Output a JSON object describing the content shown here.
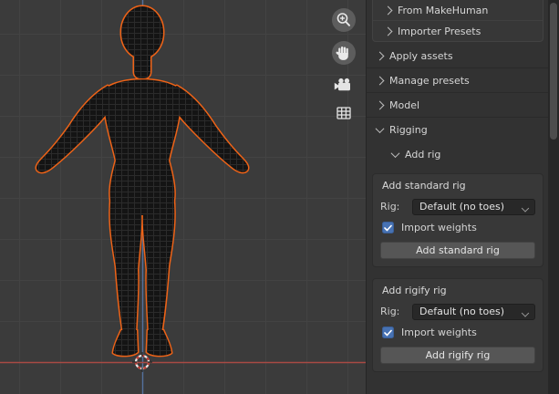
{
  "colors": {
    "selection_outline": "#ef6317",
    "checkbox_accent": "#4772b3",
    "axis_x": "#a84a44",
    "axis_z": "#54719e",
    "viewport_bg": "#3b3b3b",
    "panel_bg": "#323232"
  },
  "viewport": {
    "nav_icons": [
      "zoom-in",
      "pan-hand",
      "camera-view",
      "grid-ortho"
    ]
  },
  "sidebar": {
    "collapsed_subpanels": [
      {
        "label": "From MakeHuman"
      },
      {
        "label": "Importer Presets"
      }
    ],
    "panels": [
      {
        "label": "Apply assets"
      },
      {
        "label": "Manage presets"
      },
      {
        "label": "Model"
      },
      {
        "label": "Rigging"
      }
    ],
    "rigging": {
      "subpanel": "Add rig",
      "standard": {
        "title": "Add standard rig",
        "rig_label": "Rig:",
        "rig_value": "Default (no toes)",
        "import_weights_label": "Import weights",
        "import_weights_checked": true,
        "button_label": "Add standard rig"
      },
      "rigify": {
        "title": "Add rigify rig",
        "rig_label": "Rig:",
        "rig_value": "Default (no toes)",
        "import_weights_label": "Import weights",
        "import_weights_checked": true,
        "button_label": "Add rigify rig"
      }
    }
  }
}
